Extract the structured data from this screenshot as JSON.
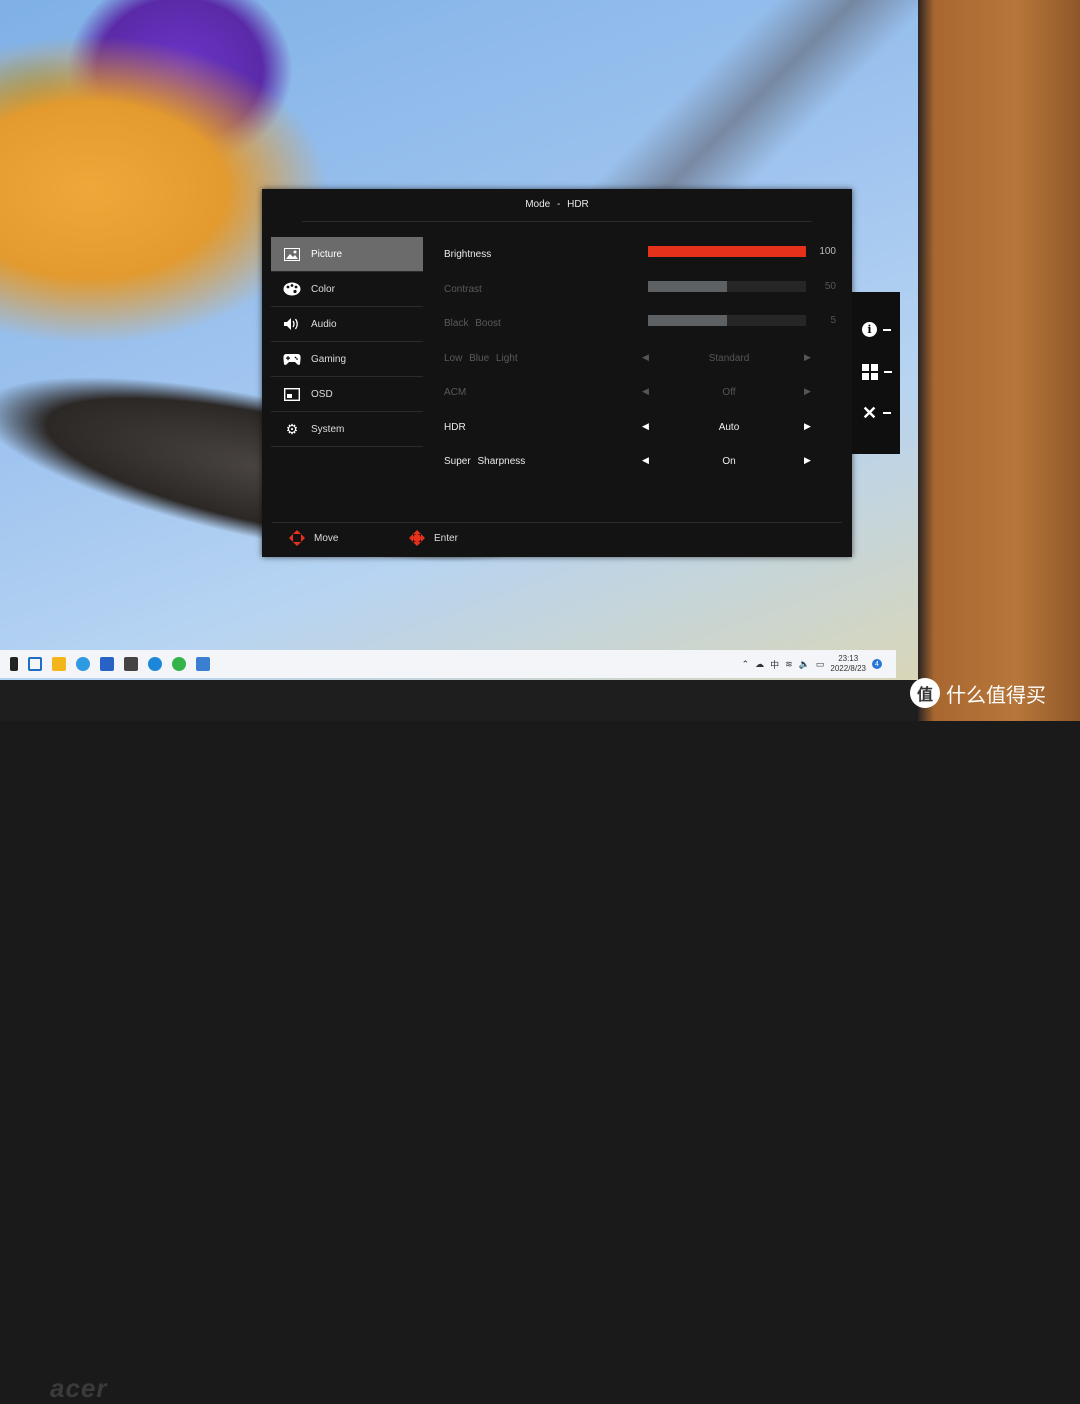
{
  "osd": {
    "title": "Mode - HDR",
    "menu": [
      {
        "label": "Picture",
        "icon": "picture-icon",
        "active": true
      },
      {
        "label": "Color",
        "icon": "palette-icon",
        "active": false
      },
      {
        "label": "Audio",
        "icon": "speaker-icon",
        "active": false
      },
      {
        "label": "Gaming",
        "icon": "gamepad-icon",
        "active": false
      },
      {
        "label": "OSD",
        "icon": "osd-icon",
        "active": false
      },
      {
        "label": "System",
        "icon": "gear-icon",
        "active": false
      }
    ],
    "settings": {
      "brightness": {
        "label": "Brightness",
        "value": "100",
        "level": 1.0
      },
      "contrast": {
        "label": "Contrast",
        "value": "50",
        "level": 0.5
      },
      "black_boost": {
        "label": "Black Boost",
        "value": "5",
        "level": 0.5
      },
      "low_blue_light": {
        "label": "Low Blue Light",
        "value": "Standard"
      },
      "acm": {
        "label": "ACM",
        "value": "Off"
      },
      "hdr": {
        "label": "HDR",
        "value": "Auto"
      },
      "super_sharpness": {
        "label": "Super Sharpness",
        "value": "On"
      }
    },
    "footer": {
      "move": "Move",
      "enter": "Enter"
    },
    "accent_color": "#e8311a"
  },
  "hotkeys": [
    "info-icon",
    "input-icon",
    "close-icon"
  ],
  "taskbar": {
    "time": "23:13",
    "date": "2022/8/23",
    "ime": "中",
    "notifications": "4"
  },
  "bezel": {
    "brand": "acer"
  },
  "watermark": {
    "badge": "值",
    "text": "什么值得买"
  }
}
